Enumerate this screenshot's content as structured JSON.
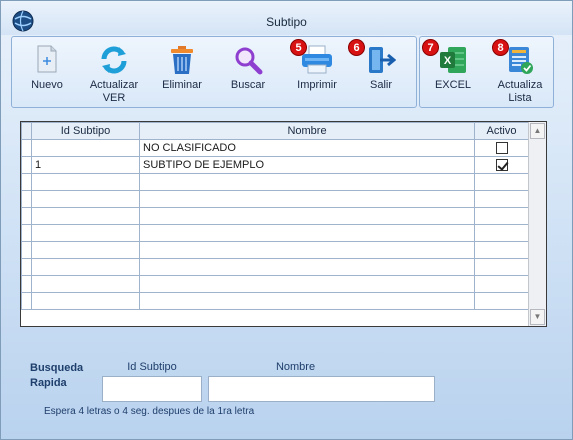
{
  "window": {
    "title": "Subtipo"
  },
  "toolbar": {
    "buttons": [
      {
        "label": "Nuevo",
        "icon": "new-document-icon"
      },
      {
        "label": "Actualizar\nVER",
        "icon": "refresh-icon"
      },
      {
        "label": "Eliminar",
        "icon": "trash-icon"
      },
      {
        "label": "Buscar",
        "icon": "magnifier-icon"
      },
      {
        "label": "Imprimir",
        "icon": "printer-icon",
        "badge": "5"
      },
      {
        "label": "Salir",
        "icon": "exit-door-icon",
        "badge": "6"
      }
    ],
    "buttons2": [
      {
        "label": "EXCEL",
        "icon": "excel-icon",
        "badge": "7"
      },
      {
        "label": "Actualiza\nLista",
        "icon": "update-list-icon",
        "badge": "8"
      }
    ]
  },
  "grid": {
    "columns": [
      "Id Subtipo",
      "Nombre",
      "Activo"
    ],
    "rows": [
      {
        "id": "",
        "nombre": "NO CLASIFICADO",
        "activo": false
      },
      {
        "id": "1",
        "nombre": "SUBTIPO DE EJEMPLO",
        "activo": true
      }
    ]
  },
  "search": {
    "title": "Busqueda Rapida",
    "id_label": "Id Subtipo",
    "nombre_label": "Nombre",
    "id_value": "",
    "nombre_value": "",
    "hint": "Espera 4 letras o 4 seg. despues de la 1ra letra"
  },
  "colors": {
    "badge": "#d81212",
    "excel": "#1f7a3c",
    "accent": "#2a78c8"
  }
}
